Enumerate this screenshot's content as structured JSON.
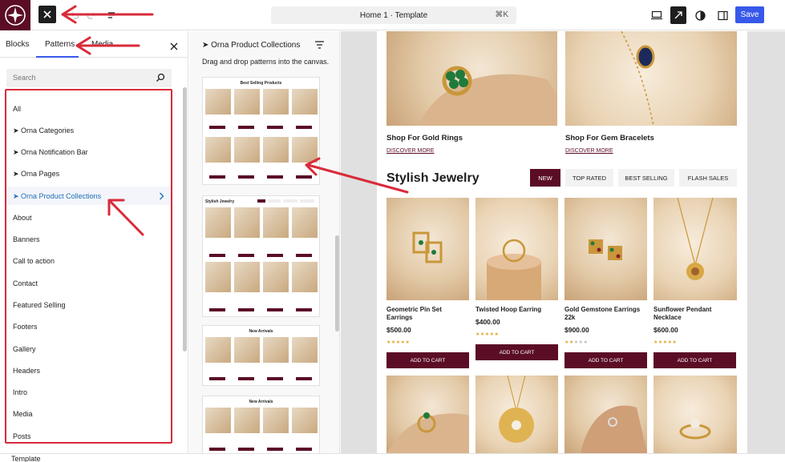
{
  "topbar": {
    "document_title": "Home 1 · Template",
    "shortcut": "⌘K",
    "save_label": "Save"
  },
  "inserter": {
    "tabs": [
      {
        "label": "Blocks"
      },
      {
        "label": "Patterns",
        "active": true
      },
      {
        "label": "Media"
      }
    ],
    "search_placeholder": "Search",
    "categories": [
      "All",
      "➤ Orna Categories",
      "➤ Orna Notification Bar",
      "➤ Orna Pages",
      "➤ Orna Product Collections",
      "About",
      "Banners",
      "Call to action",
      "Contact",
      "Featured Selling",
      "Footers",
      "Gallery",
      "Headers",
      "Intro",
      "Media",
      "Posts"
    ],
    "selected_category": "➤ Orna Product Collections"
  },
  "patterns_panel": {
    "title": "➤ Orna Product Collections",
    "description": "Drag and drop patterns into the canvas.",
    "previews": [
      {
        "title": "Best Selling Products"
      },
      {
        "title": "Stylish Jewelry"
      },
      {
        "title": "New Arrivals"
      },
      {
        "title": "New Arrivals"
      }
    ]
  },
  "canvas": {
    "promos": [
      {
        "title": "Shop For Gold Rings",
        "link": "DISCOVER MORE"
      },
      {
        "title": "Shop For Gem Bracelets",
        "link": "DISCOVER MORE"
      }
    ],
    "section_title": "Stylish Jewelry",
    "filter_tabs": [
      {
        "label": "NEW",
        "active": true
      },
      {
        "label": "TOP RATED"
      },
      {
        "label": "BEST SELLING"
      },
      {
        "label": "FLASH SALES"
      }
    ],
    "products": [
      {
        "name": "Geometric Pin Set Earrings",
        "price": "$500.00",
        "rating": 5,
        "button": "ADD TO CART"
      },
      {
        "name": "Twisted Hoop Earring",
        "price": "$400.00",
        "rating": 5,
        "button": "ADD TO CART"
      },
      {
        "name": "Gold Gemstone Earrings 22k",
        "price": "$900.00",
        "rating": 2,
        "button": "ADD TO CART"
      },
      {
        "name": "Sunflower Pendant Necklace",
        "price": "$600.00",
        "rating": 5,
        "button": "ADD TO CART"
      }
    ]
  },
  "footer": {
    "breadcrumb": "Template"
  },
  "colors": {
    "brand": "#5b0d26",
    "accent": "#3858e9",
    "annotation": "#d92b3a",
    "star": "#e0a82e"
  }
}
